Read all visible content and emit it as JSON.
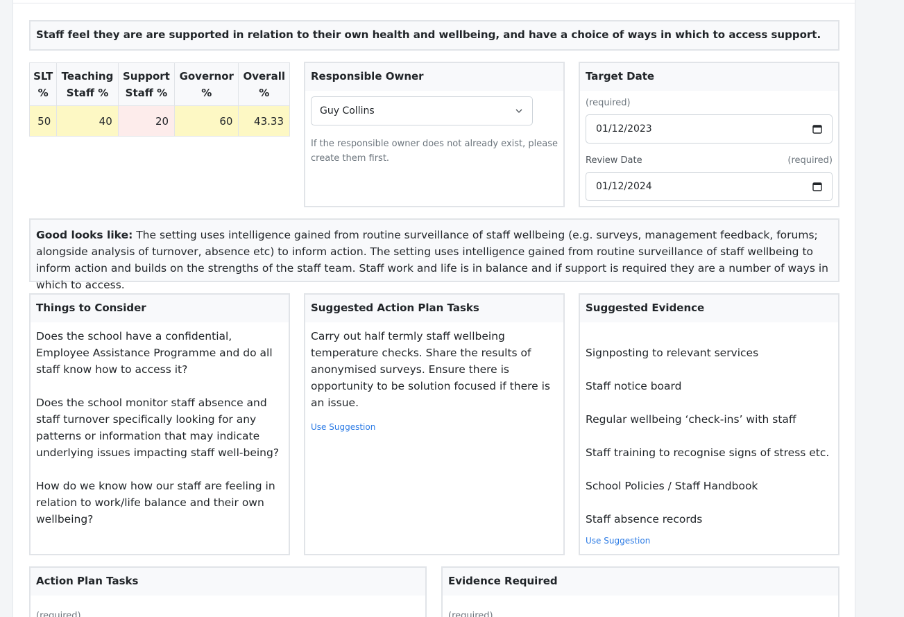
{
  "statement": "Staff feel they are are supported in relation to their own health and wellbeing, and have a choice of ways in which to access support.",
  "scores": {
    "headers": [
      [
        "SLT",
        "%"
      ],
      [
        "Teaching",
        "Staff %"
      ],
      [
        "Support",
        "Staff %"
      ],
      [
        "Governor",
        "%"
      ],
      [
        "Overall",
        "%"
      ]
    ],
    "values": [
      "50",
      "40",
      "20",
      "60",
      "43.33"
    ],
    "colors": {
      "medium": "#fdf8c4",
      "low": "#fdeceb"
    }
  },
  "owner": {
    "title": "Responsible Owner",
    "selected": "Guy Collins",
    "hint": "If the responsible owner does not already exist, please create them first."
  },
  "target": {
    "title": "Target Date",
    "required": "(required)",
    "target_value": "01/12/2023",
    "review_label": "Review Date",
    "review_required": "(required)",
    "review_value": "01/12/2024"
  },
  "good_looks_like": {
    "label": "Good looks like:",
    "text": " The setting uses intelligence gained from routine surveillance of staff wellbeing (e.g. surveys, management feedback, forums; alongside analysis of turnover, absence etc) to inform action. The setting uses intelligence gained from routine surveillance of staff wellbeing to inform action and builds on the strengths of the staff team. Staff work and life is in balance and if support is required they are a number of ways in which to access."
  },
  "consider": {
    "title": "Things to Consider",
    "items": [
      "Does the school have a confidential, Employee Assistance Programme and do all staff know how to access it?",
      "Does the school monitor staff absence and staff turnover specifically looking for any patterns or information that may indicate underlying issues impacting staff well-being?",
      "How do we know how our staff are feeling in relation to work/life balance and their own wellbeing?"
    ]
  },
  "suggested_tasks": {
    "title": "Suggested Action Plan Tasks",
    "text": "Carry out half termly staff wellbeing temperature checks. Share the results of anonymised surveys. Ensure there is opportunity to be solution focused if there is an issue.",
    "link": "Use Suggestion"
  },
  "suggested_evidence": {
    "title": "Suggested Evidence",
    "items": [
      "Signposting to relevant services",
      "Staff notice board",
      "Regular wellbeing ‘check-ins’ with staff",
      "Staff training to recognise signs of stress etc.",
      "School Policies / Staff Handbook",
      "Staff absence records"
    ],
    "link": "Use Suggestion"
  },
  "action_plan": {
    "title": "Action Plan Tasks",
    "required": "(required)"
  },
  "evidence_required": {
    "title": "Evidence Required",
    "required": "(required)"
  }
}
